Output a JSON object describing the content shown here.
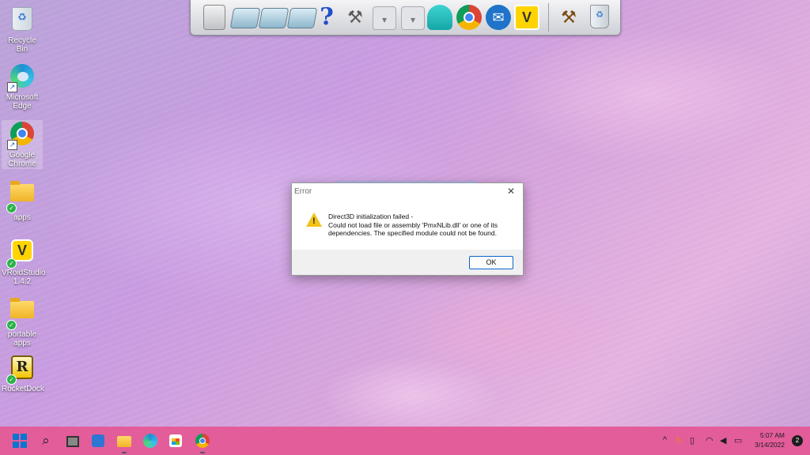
{
  "desktop": {
    "icons": [
      {
        "label": "Recycle Bin",
        "icon": "recycle-bin-icon"
      },
      {
        "label": "Microsoft Edge",
        "icon": "edge-icon"
      },
      {
        "label": "Google Chrome",
        "icon": "chrome-icon"
      },
      {
        "label": "apps",
        "icon": "folder-icon"
      },
      {
        "label": "VRoidStudio 1.4.2",
        "icon": "vroid-icon"
      },
      {
        "label": "portable apps",
        "icon": "folder-icon"
      },
      {
        "label": "RocketDock",
        "icon": "rocketdock-icon"
      }
    ]
  },
  "dock": {
    "items": [
      {
        "name": "computer-icon",
        "glyph": "🖥"
      },
      {
        "name": "folder-icon"
      },
      {
        "name": "folder-icon"
      },
      {
        "name": "folder-icon"
      },
      {
        "name": "help-icon",
        "glyph": "?"
      },
      {
        "name": "tools-icon",
        "glyph": "⚒"
      },
      {
        "name": "arrow-icon",
        "glyph": "▾"
      },
      {
        "name": "arrow-icon",
        "glyph": "▾"
      },
      {
        "name": "miku-icon"
      },
      {
        "name": "chrome-icon"
      },
      {
        "name": "mail-icon",
        "glyph": "✉"
      },
      {
        "name": "vroid-icon",
        "glyph": "V"
      },
      {
        "name": "wrench-icon",
        "glyph": "⚒"
      },
      {
        "name": "recycle-bin-icon"
      }
    ]
  },
  "dialog": {
    "title": "Error",
    "close_glyph": "✕",
    "message_line1": "Direct3D initialization failed -",
    "message_line2": "Could not load file or assembly 'PmxNLib.dll' or one of its dependencies. The specified module could not be found.",
    "ok_label": "OK",
    "icon": "warning-icon"
  },
  "taskbar": {
    "apps": [
      "start-icon",
      "search-icon",
      "task-view-icon",
      "widgets-icon",
      "file-explorer-icon",
      "edge-icon",
      "store-icon",
      "chrome-icon"
    ],
    "tray": {
      "icons": [
        "chevron-up-icon",
        "sync-icon",
        "usb-icon",
        "wifi-icon",
        "volume-icon",
        "battery-icon"
      ]
    },
    "time": "5:07 AM",
    "date": "3/14/2022",
    "notification_count": "2"
  },
  "colors": {
    "taskbar": "#e35d9b",
    "warning": "#f2c318",
    "ok_border": "#0a64c8"
  }
}
